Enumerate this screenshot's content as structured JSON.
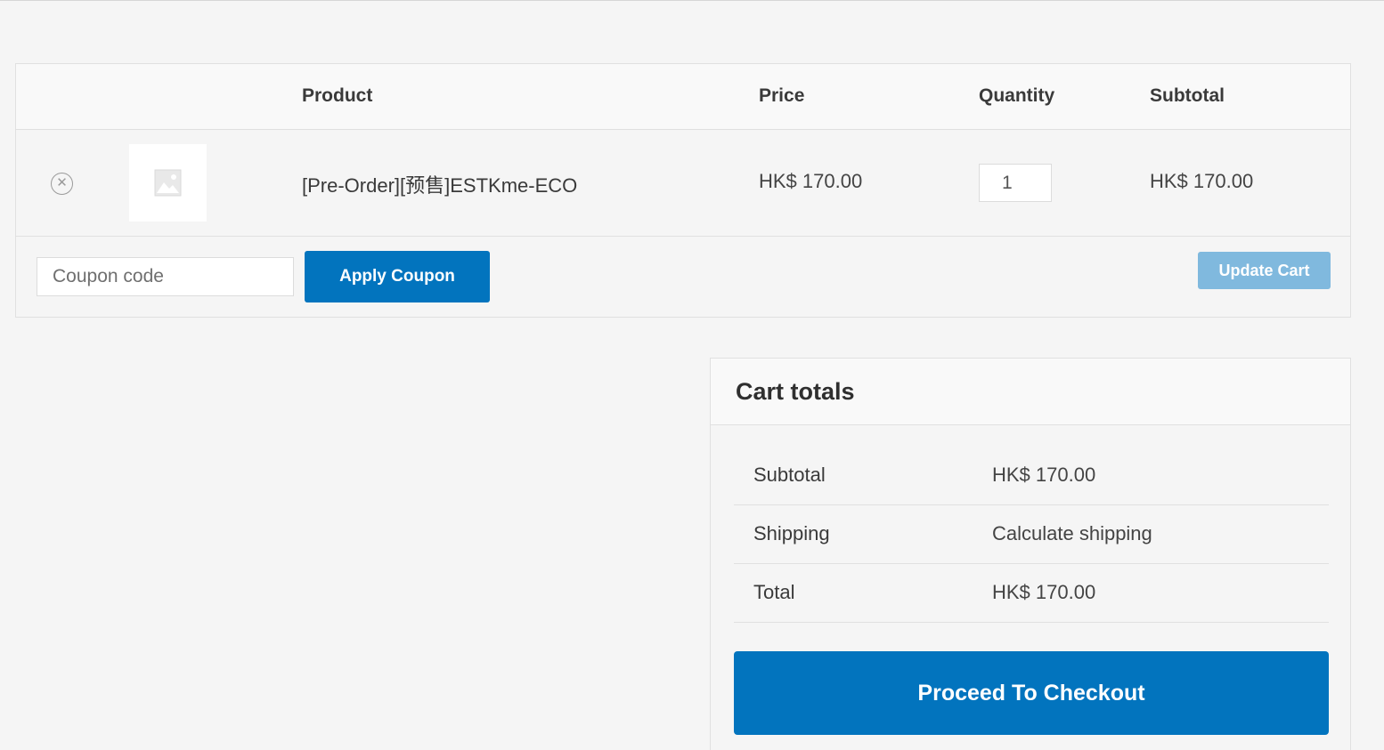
{
  "cart_table": {
    "headers": {
      "product": "Product",
      "price": "Price",
      "quantity": "Quantity",
      "subtotal": "Subtotal"
    },
    "items": [
      {
        "remove_icon": "close-circle-icon",
        "thumbnail_icon": "image-placeholder-icon",
        "name": "[Pre-Order][预售]ESTKme-ECO",
        "price": "HK$  170.00",
        "quantity": "1",
        "subtotal": "HK$  170.00"
      }
    ],
    "coupon": {
      "placeholder": "Coupon code",
      "value": "",
      "apply_label": "Apply Coupon"
    },
    "update_label": "Update Cart"
  },
  "cart_totals": {
    "title": "Cart totals",
    "rows": [
      {
        "label": "Subtotal",
        "value": "HK$  170.00"
      },
      {
        "label": "Shipping",
        "value": "Calculate shipping"
      },
      {
        "label": "Total",
        "value": "HK$  170.00"
      }
    ],
    "checkout_label": "Proceed To Checkout"
  },
  "colors": {
    "accent": "#0274be",
    "accent_disabled": "#80b9de",
    "background": "#f5f5f5",
    "header_bg": "#f9f9f9",
    "border": "#e0e0e0"
  }
}
